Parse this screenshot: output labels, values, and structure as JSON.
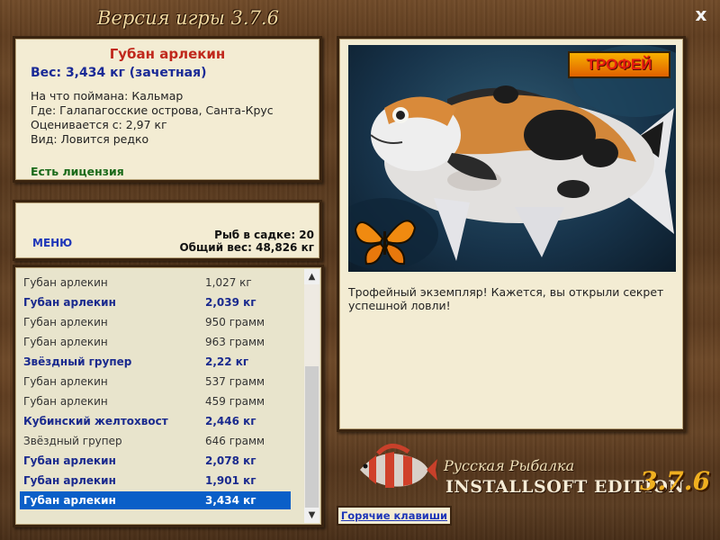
{
  "window": {
    "title": "Версия игры 3.7.6",
    "close_label": "x"
  },
  "catch_info": {
    "fish_name": "Губан арлекин",
    "weight": "Вес: 3,434 кг (зачетная)",
    "bait": "На что поймана: Кальмар",
    "location": "Где: Галапагосские острова, Санта-Крус",
    "valuation": "Оценивается с: 2,97 кг",
    "species": "Вид: Ловится редко",
    "license": "Есть лицензия"
  },
  "menu": {
    "menu_label": "МЕНЮ",
    "fish_in_cage": "Рыб в садке: 20",
    "total_weight": "Общий вес: 48,826 кг"
  },
  "catch_list": [
    {
      "name": "Губан арлекин",
      "weight": "1,027 кг",
      "style": "normal"
    },
    {
      "name": "Губан арлекин",
      "weight": "2,039 кг",
      "style": "bold"
    },
    {
      "name": "Губан арлекин",
      "weight": "950 грамм",
      "style": "normal"
    },
    {
      "name": "Губан арлекин",
      "weight": "963 грамм",
      "style": "normal"
    },
    {
      "name": "Звёздный групер",
      "weight": "2,22 кг",
      "style": "bold"
    },
    {
      "name": "Губан арлекин",
      "weight": "537 грамм",
      "style": "normal"
    },
    {
      "name": "Губан арлекин",
      "weight": "459 грамм",
      "style": "normal"
    },
    {
      "name": "Кубинский желтохвост",
      "weight": "2,446 кг",
      "style": "bold"
    },
    {
      "name": "Звёздный групер",
      "weight": "646 грамм",
      "style": "normal"
    },
    {
      "name": "Губан арлекин",
      "weight": "2,078 кг",
      "style": "bold"
    },
    {
      "name": "Губан арлекин",
      "weight": "1,901 кг",
      "style": "bold"
    },
    {
      "name": "Губан арлекин",
      "weight": "3,434 кг",
      "style": "selected"
    }
  ],
  "photo": {
    "trophy_label": "ТРОФЕЙ",
    "caption": "Трофейный экземпляр! Кажется, вы открыли секрет успешной ловли!"
  },
  "footer": {
    "hotkeys_label": "Горячие клавиши",
    "brand_sub": "Русская Рыбалка",
    "brand_main": "INSTALLSOFT EDITION",
    "brand_version": "3.7.6"
  },
  "colors": {
    "selection": "#0a5fc8",
    "fish_name": "#c0281c",
    "weight_text": "#1a2a96",
    "license_text": "#1a6a1a",
    "trophy_bg": "#f0a000"
  }
}
